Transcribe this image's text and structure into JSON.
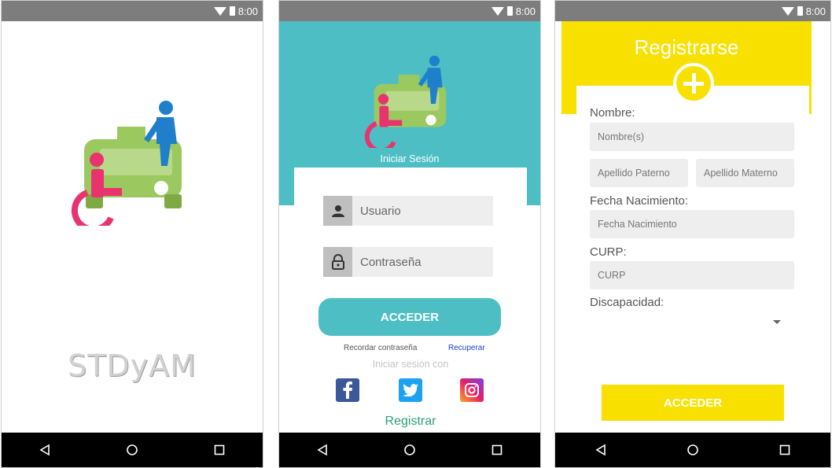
{
  "status_bar": {
    "time": "8:00"
  },
  "nav_bar": {
    "back": "back-icon",
    "home": "home-icon",
    "recents": "recents-icon"
  },
  "splash": {
    "app_name": "STDyAM"
  },
  "login": {
    "caption": "Iniciar Sesión",
    "username_placeholder": "Usuario",
    "password_placeholder": "Contraseña",
    "submit_label": "ACCEDER",
    "remember_label": "Recordar contraseña",
    "recover_label": "Recuperar",
    "social_label": "Iniciar sesión con",
    "social": [
      "facebook-icon",
      "twitter-icon",
      "instagram-icon"
    ],
    "register_label": "Registrar",
    "colors": {
      "accent": "#4dbfc4",
      "register": "#2aa176",
      "recover": "#1d3fd0"
    }
  },
  "register": {
    "title": "Registrarse",
    "name_label": "Nombre:",
    "name_placeholder": "Nombre(s)",
    "last1_placeholder": "Apellido Paterno",
    "last2_placeholder": "Apellido Materno",
    "birth_label": "Fecha Nacimiento:",
    "birth_placeholder": "Fecha Nacimiento",
    "curp_label": "CURP:",
    "curp_placeholder": "CURP",
    "disability_label": "Discapacidad:",
    "submit_label": "ACCEDER",
    "colors": {
      "accent": "#f8e100"
    }
  }
}
